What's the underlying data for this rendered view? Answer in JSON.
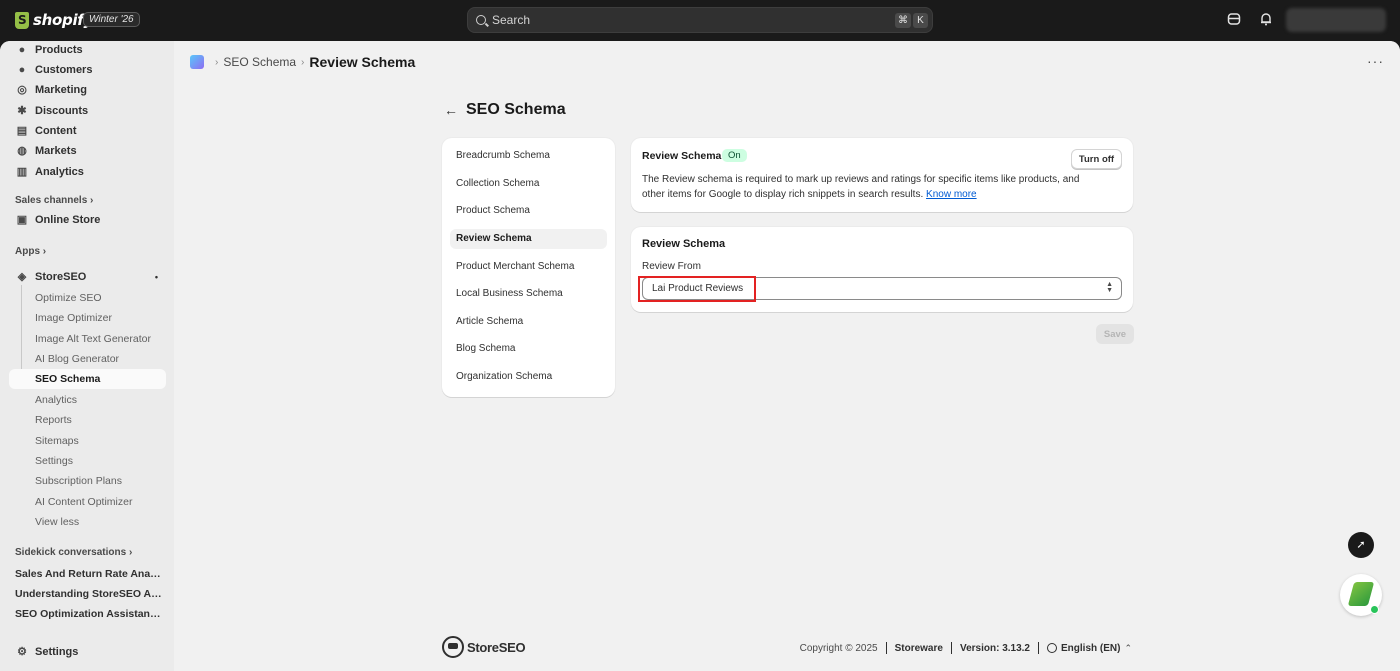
{
  "topbar": {
    "brand": "shopify",
    "edition_badge": "Winter '26",
    "search_placeholder": "Search",
    "shortcut_cmd": "⌘",
    "shortcut_key": "K"
  },
  "sidebar": {
    "nav": [
      {
        "label": "Products",
        "icon": "tag-icon"
      },
      {
        "label": "Customers",
        "icon": "person-icon"
      },
      {
        "label": "Marketing",
        "icon": "target-icon"
      },
      {
        "label": "Discounts",
        "icon": "discount-icon"
      },
      {
        "label": "Content",
        "icon": "content-icon"
      },
      {
        "label": "Markets",
        "icon": "globe-icon"
      },
      {
        "label": "Analytics",
        "icon": "chart-icon"
      }
    ],
    "sales_channels_label": "Sales channels",
    "online_store": "Online Store",
    "apps_label": "Apps",
    "app_name": "StoreSEO",
    "app_subitems": [
      "Optimize SEO",
      "Image Optimizer",
      "Image Alt Text Generator",
      "AI Blog Generator",
      "SEO Schema",
      "Analytics",
      "Reports",
      "Sitemaps",
      "Settings",
      "Subscription Plans",
      "AI Content Optimizer",
      "View less"
    ],
    "sidekick_label": "Sidekick conversations",
    "sidekick_items": [
      "Sales And Return Rate Analytics",
      "Understanding StoreSEO App Features",
      "SEO Optimization Assistance For Products"
    ],
    "settings": "Settings"
  },
  "breadcrumb": {
    "parent": "SEO Schema",
    "current": "Review Schema"
  },
  "page": {
    "title": "SEO Schema",
    "schema_list": [
      "Breadcrumb Schema",
      "Collection Schema",
      "Product Schema",
      "Review Schema",
      "Product Merchant Schema",
      "Local Business Schema",
      "Article Schema",
      "Blog Schema",
      "Organization Schema"
    ],
    "active_schema": "Review Schema",
    "info_card": {
      "title": "Review Schema",
      "status": "On",
      "button": "Turn off",
      "description": "The Review schema is required to mark up reviews and ratings for specific items like products, and other items for Google to display rich snippets in search results.",
      "link": "Know more"
    },
    "form_card": {
      "title": "Review Schema",
      "field_label": "Review From",
      "field_value": "Lai Product Reviews"
    },
    "save_button": "Save"
  },
  "footer": {
    "logo": "StoreSEO",
    "copyright": "Copyright © 2025",
    "company": "Storeware",
    "version": "Version: 3.13.2",
    "language": "English (EN)"
  },
  "colors": {
    "topbar": "#1a1a1a",
    "on_badge_bg": "#cdfee1",
    "link": "#005bd3",
    "highlight": "#e32222"
  }
}
